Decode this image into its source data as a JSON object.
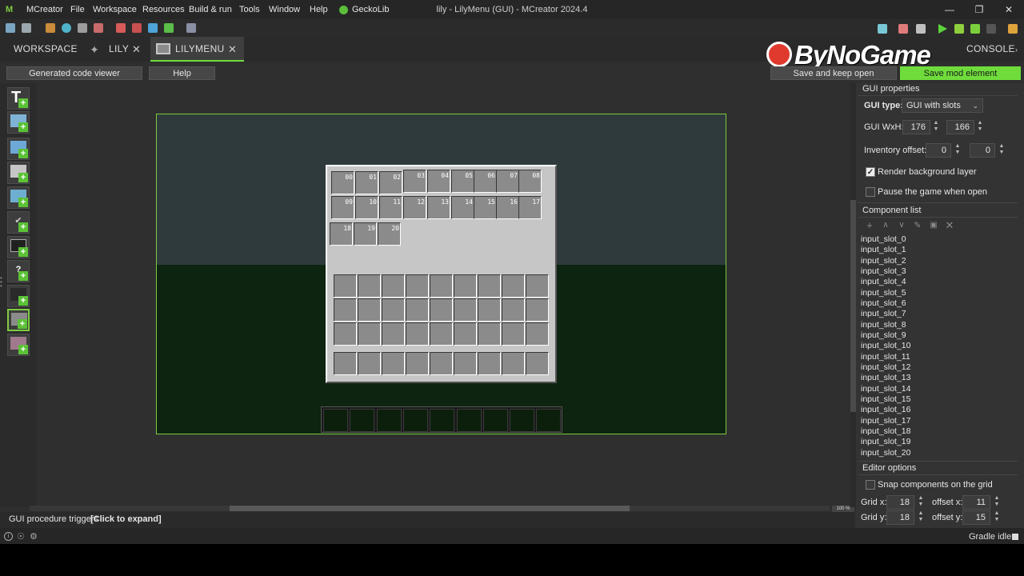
{
  "app": {
    "menu": [
      "MCreator",
      "File",
      "Workspace",
      "Resources",
      "Build & run",
      "Tools",
      "Window",
      "Help",
      "GeckoLib"
    ],
    "title": "lily - LilyMenu (GUI) - MCreator 2024.4",
    "window_controls": [
      "—",
      "❐",
      "✕"
    ]
  },
  "tabs": {
    "workspace": "WORKSPACE",
    "lily": "LILY",
    "lilymenu": "LILYMENU",
    "console": "CONSOLE",
    "close": "✕"
  },
  "actions": {
    "code_viewer": "Generated code viewer",
    "help": "Help",
    "save_keep_open": "Save and keep open",
    "save_mod": "Save mod element"
  },
  "watermark": "ByNoGame",
  "gui_properties": {
    "header": "GUI properties",
    "type_label": "GUI type:",
    "type_value": "GUI with slots",
    "wxh_label": "GUI WxH:",
    "width": "176",
    "height": "166",
    "inv_offset_label": "Inventory offset:",
    "inv_x": "0",
    "inv_y": "0",
    "render_bg": "Render background layer",
    "render_bg_checked": true,
    "pause": "Pause the game when open",
    "pause_checked": false
  },
  "component_list": {
    "header": "Component list",
    "items": [
      "input_slot_0",
      "input_slot_1",
      "input_slot_2",
      "input_slot_3",
      "input_slot_4",
      "input_slot_5",
      "input_slot_6",
      "input_slot_7",
      "input_slot_8",
      "input_slot_9",
      "input_slot_10",
      "input_slot_11",
      "input_slot_12",
      "input_slot_13",
      "input_slot_14",
      "input_slot_15",
      "input_slot_16",
      "input_slot_17",
      "input_slot_18",
      "input_slot_19",
      "input_slot_20"
    ]
  },
  "editor_options": {
    "header": "Editor options",
    "snap": "Snap components on the grid",
    "snap_checked": false,
    "grid_x_label": "Grid x:",
    "grid_x": "18",
    "grid_y_label": "Grid y:",
    "grid_y": "18",
    "offset_x_label": "offset x:",
    "offset_x": "11",
    "offset_y_label": "offset y:",
    "offset_y": "15"
  },
  "canvas": {
    "slot_labels": [
      "00",
      "01",
      "02",
      "03",
      "04",
      "05",
      "06",
      "07",
      "08",
      "09",
      "10",
      "11",
      "12",
      "13",
      "14",
      "15",
      "16",
      "17",
      "18",
      "19",
      "20"
    ],
    "zoom": "100 %"
  },
  "bottom": {
    "triggers_label": "GUI procedure triggers",
    "triggers_expand": "[Click to expand]",
    "status": "Gradle idle"
  },
  "colors": {
    "accent_green": "#6fdc3c",
    "canvas_border": "#7ecb3f"
  }
}
